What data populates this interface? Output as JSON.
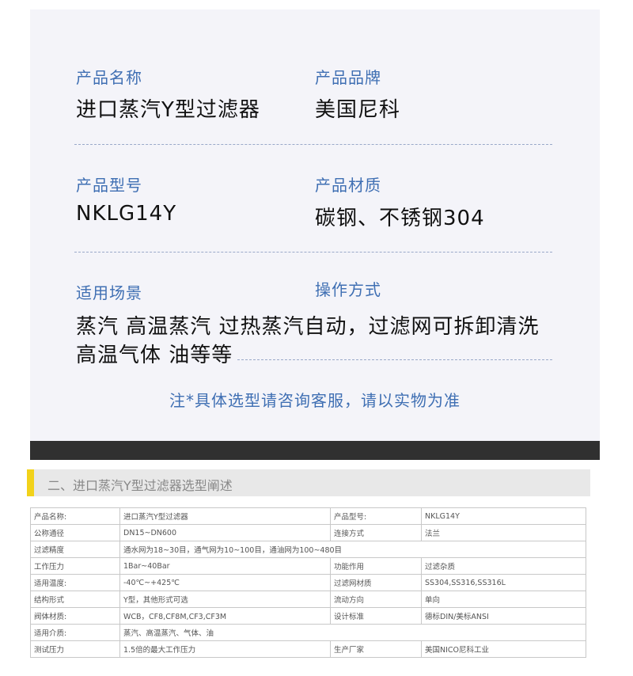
{
  "card": {
    "name_label": "产品名称",
    "name_value": "进口蒸汽Y型过滤器",
    "brand_label": "产品品牌",
    "brand_value": "美国尼科",
    "model_label": "产品型号",
    "model_value": "NKLG14Y",
    "material_label": "产品材质",
    "material_value": "碳钢、不锈钢304",
    "scene_label": "适用场景",
    "operation_label": "操作方式",
    "scene_value_line1": "蒸汽 高温蒸汽 过热蒸汽自动，过滤网可拆卸清洗",
    "scene_value_line2": "高温气体 油等等",
    "note": "注*具体选型请咨询客服，请以实物为准"
  },
  "section": {
    "title": "二、进口蒸汽Y型过滤器选型阐述"
  },
  "specs": {
    "rows": [
      [
        "产品名称:",
        "进口蒸汽Y型过滤器",
        "产品型号:",
        "NKLG14Y"
      ],
      [
        "公称通径",
        "DN15~DN600",
        "连接方式",
        "法兰"
      ],
      [
        "过滤精度",
        "通水网为18~30目，通气网为10~100目，通油网为100~480目"
      ],
      [
        "工作压力",
        "1Bar~40Bar",
        "功能作用",
        "过滤杂质"
      ],
      [
        "适用温度:",
        "-40℃~+425℃",
        "过滤网材质",
        "SS304,SS316,SS316L"
      ],
      [
        "结构形式",
        "Y型，其他形式可选",
        "流动方向",
        "单向"
      ],
      [
        "阀体材质:",
        "WCB，CF8,CF8M,CF3,CF3M",
        "设计标准",
        "德标DIN/美标ANSI"
      ],
      [
        "适用介质:",
        "蒸汽、高温蒸汽、气体、油"
      ],
      [
        "测试压力",
        "1.5倍的最大工作压力",
        "生产厂家",
        "美国NICO尼科工业"
      ]
    ]
  }
}
